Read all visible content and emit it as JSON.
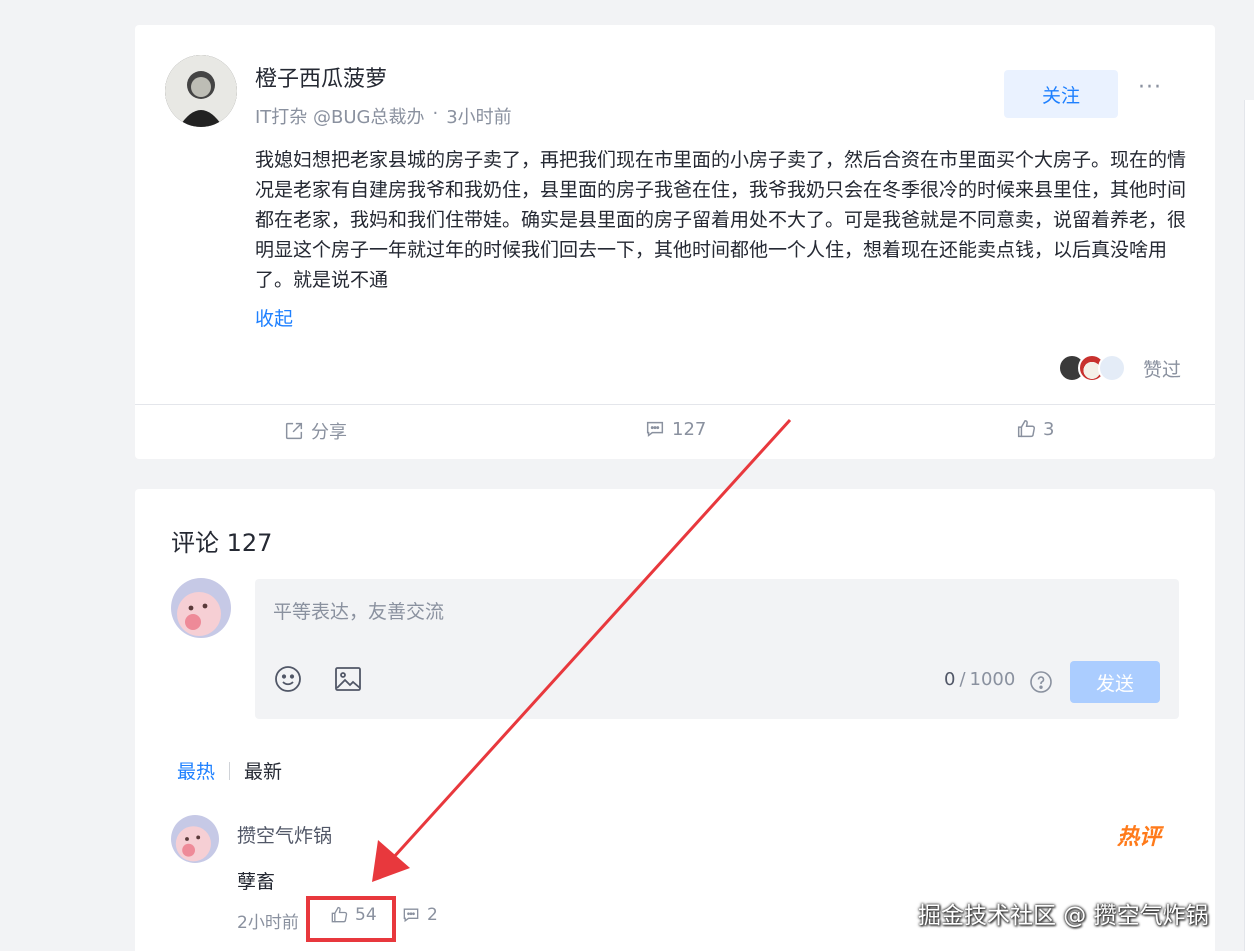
{
  "post": {
    "author": "橙子西瓜菠萝",
    "role": "IT打杂 @BUG总裁办",
    "dot": "·",
    "time": "3小时前",
    "follow_label": "关注",
    "more_label": "···",
    "content": "我媳妇想把老家县城的房子卖了，再把我们现在市里面的小房子卖了，然后合资在市里面买个大房子。现在的情况是老家有自建房我爷和我奶住，县里面的房子我爸在住，我爷我奶只会在冬季很冷的时候来县里住，其他时间都在老家，我妈和我们住带娃。确实是县里面的房子留着用处不大了。可是我爸就是不同意卖，说留着养老，很明显这个房子一年就过年的时候我们回去一下，其他时间都他一个人住，想着现在还能卖点钱，以后真没啥用了。就是说不通",
    "collapse_label": "收起",
    "liked_label": "赞过",
    "actions": {
      "share_label": "分享",
      "comment_count": "127",
      "like_count": "3"
    }
  },
  "comments": {
    "title": "评论 127",
    "input_placeholder": "平等表达，友善交流",
    "counter_current": "0",
    "counter_sep": " / ",
    "counter_max": "1000",
    "send_label": "发送",
    "sort_hot": "最热",
    "sort_new": "最新",
    "items": [
      {
        "name": "攒空气炸锅",
        "text": "孽畜",
        "time": "2小时前",
        "likes": "54",
        "replies": "2",
        "badge": "热评"
      }
    ]
  },
  "watermark": "掘金技术社区 @ 攒空气炸锅",
  "icons": [
    "share-icon",
    "comment-icon",
    "thumb-up-icon",
    "emoji-icon",
    "image-icon",
    "help-icon",
    "more-icon"
  ],
  "colors": {
    "accent": "#1e80ff",
    "follow_bg": "#eaf2ff",
    "send_disabled": "#abcdff",
    "annotation_red": "#e8383d",
    "hot_badge": "#ff7a1a"
  }
}
